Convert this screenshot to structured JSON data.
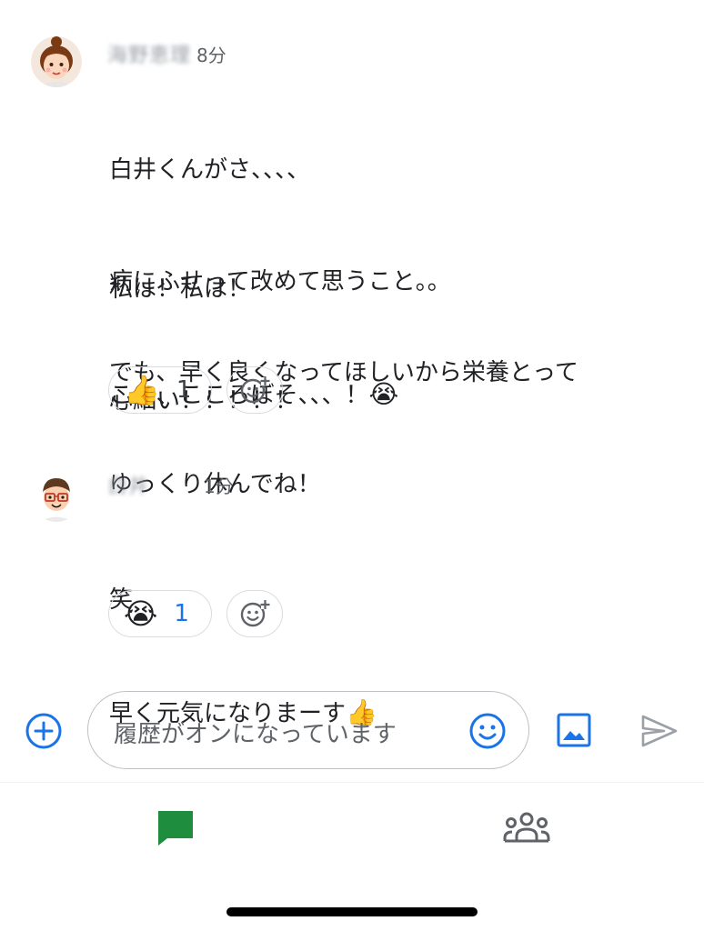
{
  "messages": [
    {
      "author": "海野恵理",
      "time": "8分",
      "paragraphs": [
        [
          "白井くんがさ、、、、",
          "病にふせって改めて思うこと。。",
          "こ、、、こころぼそ、、、！"
        ],
        [
          "私は！私は！",
          "心細い！！！！！"
        ],
        [
          "でも、早く良くなってほしいから栄養とって",
          "ゆっくり休んでね！"
        ]
      ],
      "inline_emoji": "😭",
      "reaction": {
        "emoji": "👍",
        "count": "1"
      }
    },
    {
      "author": "白井",
      "time": "1分",
      "lines": [
        "笑",
        "早く元気になりまーす"
      ],
      "inline_emoji": "👍",
      "reaction": {
        "emoji": "😭",
        "count": "1"
      }
    }
  ],
  "composer": {
    "placeholder": "履歴がオンになっています"
  },
  "icons": {
    "add": "plus-circle-icon",
    "emoji": "smile-icon",
    "image": "image-icon",
    "send": "send-icon",
    "chat": "chat-icon",
    "people": "people-icon"
  },
  "colors": {
    "accent": "#1a73e8",
    "chat_green": "#1e8e3e",
    "send_gray": "#9aa0a6"
  }
}
